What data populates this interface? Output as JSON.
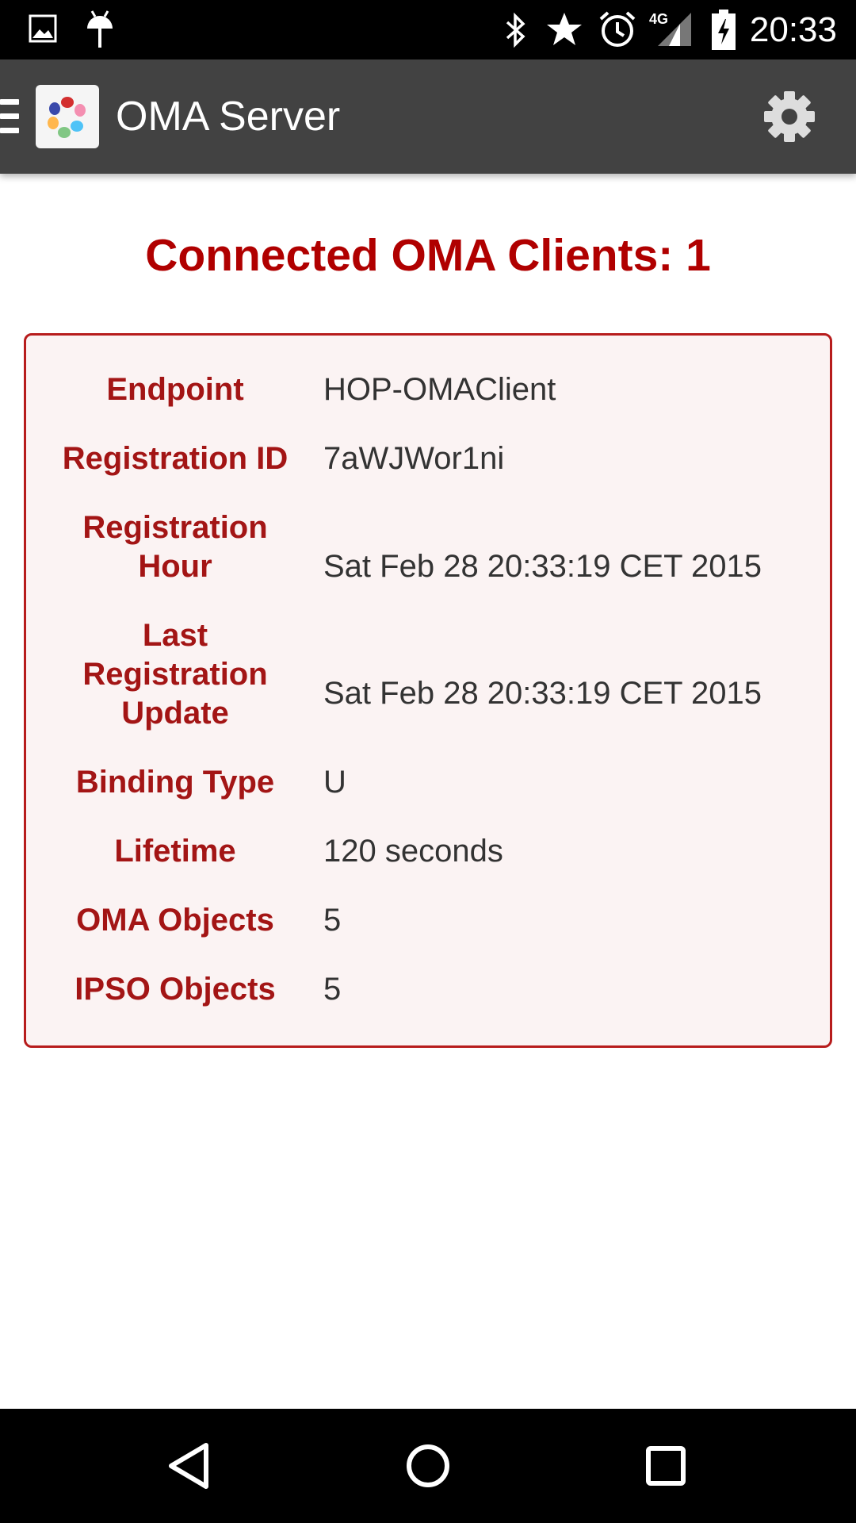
{
  "status_bar": {
    "time": "20:33",
    "network_label": "4G",
    "icons": [
      "image-notification-icon",
      "android-notification-icon",
      "bluetooth-icon",
      "star-icon",
      "alarm-icon",
      "signal-4g-icon",
      "battery-charging-icon"
    ]
  },
  "action_bar": {
    "title": "OMA Server",
    "menu_icon": "drawer-menu-icon",
    "settings_icon": "gear-icon"
  },
  "main": {
    "headline": "Connected OMA Clients: 1"
  },
  "client": {
    "endpoint_label": "Endpoint",
    "endpoint": "HOP-OMAClient",
    "registration_id_label": "Registration ID",
    "registration_id": "7aWJWor1ni",
    "registration_hour_label": [
      "Registration",
      "Hour"
    ],
    "registration_hour": "Sat Feb 28 20:33:19 CET 2015",
    "last_update_label": [
      "Last",
      "Registration",
      "Update"
    ],
    "last_update": "Sat Feb 28 20:33:19 CET 2015",
    "binding_type_label": "Binding Type",
    "binding_type": "U",
    "lifetime_label": "Lifetime",
    "lifetime": "120 seconds",
    "oma_objects_label": "OMA Objects",
    "oma_objects": "5",
    "ipso_objects_label": "IPSO Objects",
    "ipso_objects": "5"
  },
  "nav_bar": {
    "icons": [
      "back-icon",
      "home-icon",
      "recents-icon"
    ]
  },
  "colors": {
    "accent": "#b00000",
    "label": "#a31515",
    "card_border": "#b71c1c",
    "card_bg": "#fbf3f3",
    "action_bar": "#424242"
  }
}
